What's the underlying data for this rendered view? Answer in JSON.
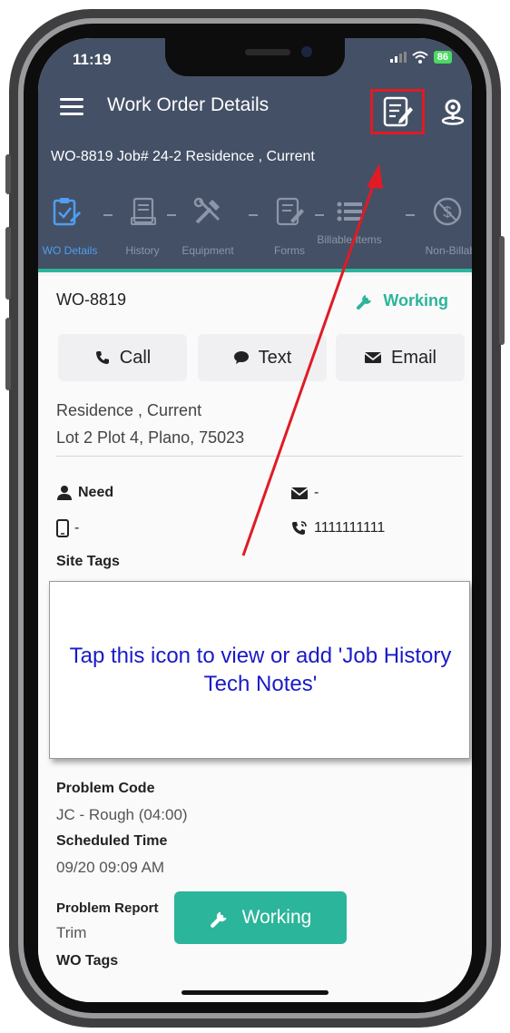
{
  "status_bar": {
    "time": "11:19",
    "battery": "86"
  },
  "header": {
    "title": "Work Order Details"
  },
  "subheader": {
    "text": "WO-8819  Job# 24-2  Residence , Current"
  },
  "tabs": [
    {
      "label": "WO Details",
      "icon": "clipboard-check-icon",
      "active": true
    },
    {
      "label": "History",
      "icon": "history-icon",
      "active": false
    },
    {
      "label": "Equipment",
      "icon": "tools-icon",
      "active": false
    },
    {
      "label": "Forms",
      "icon": "form-edit-icon",
      "active": false
    },
    {
      "label": "Billable Items",
      "icon": "list-icon",
      "active": false
    },
    {
      "label": "Non-Billable",
      "icon": "non-billable-icon",
      "active": false
    }
  ],
  "work_order": {
    "id": "WO-8819",
    "status": "Working",
    "actions": {
      "call": "Call",
      "text": "Text",
      "email": "Email"
    },
    "address_line1": "Residence , Current",
    "address_line2": "Lot 2 Plot 4, Plano, 75023",
    "contact_name": "Need",
    "contact_email": "-",
    "contact_mobile": "-",
    "contact_phone": "1111111111"
  },
  "labels": {
    "site_tags": "Site Tags",
    "problem_code": "Problem Code",
    "scheduled_time": "Scheduled Time",
    "problem_report": "Problem Report",
    "wo_tags": "WO Tags"
  },
  "values": {
    "problem_code": "JC - Rough (04:00)",
    "scheduled_time": "09/20 09:09 AM",
    "problem_report": "Trim"
  },
  "callout": {
    "text": "Tap this icon to view or add 'Job History Tech Notes'"
  },
  "bottom_button": {
    "label": "Working"
  },
  "colors": {
    "header": "#445066",
    "accent": "#2bb59a",
    "highlight": "#e01b24",
    "callout_text": "#1a1ac8"
  }
}
